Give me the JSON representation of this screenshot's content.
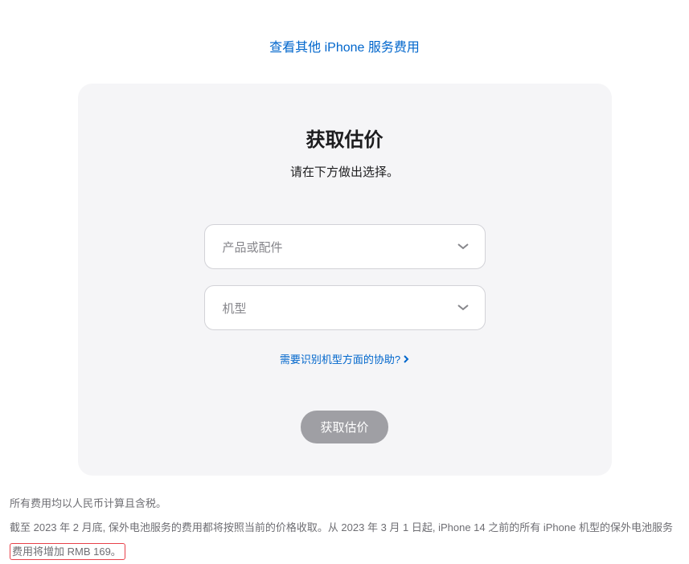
{
  "topLink": "查看其他 iPhone 服务费用",
  "card": {
    "title": "获取估价",
    "subtitle": "请在下方做出选择。",
    "select1": "产品或配件",
    "select2": "机型",
    "helpLink": "需要识别机型方面的协助?",
    "submit": "获取估价"
  },
  "disclaimer": {
    "line1": "所有费用均以人民币计算且含税。",
    "line2a": "截至 2023 年 2 月底, 保外电池服务的费用都将按照当前的价格收取。从 2023 年 3 月 1 日起, iPhone 14 之前的所有 iPhone 机型的保外电池服务",
    "line2b": "费用将增加 RMB 169。"
  }
}
